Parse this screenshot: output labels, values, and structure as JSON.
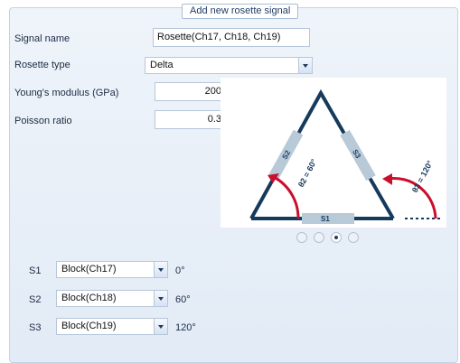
{
  "dialog": {
    "title": "Add new rosette signal"
  },
  "fields": {
    "signal_name_label": "Signal name",
    "signal_name_value": "Rosette(Ch17, Ch18, Ch19)",
    "rosette_type_label": "Rosette type",
    "rosette_type_value": "Delta",
    "youngs_modulus_label": "Young's modulus (GPa)",
    "youngs_modulus_value": "200",
    "poisson_ratio_label": "Poisson ratio",
    "poisson_ratio_value": "0.3"
  },
  "diagram": {
    "gauge_labels": [
      "S1",
      "S2",
      "S3"
    ],
    "angle_labels": [
      "θ2 = 60°",
      "θ3 = 120°"
    ],
    "colors": {
      "frame": "#163a5c",
      "gauge": "#b8c9d8",
      "arc": "#c8102e"
    }
  },
  "carousel": {
    "count": 4,
    "active_index": 2
  },
  "channels": [
    {
      "label": "S1",
      "source": "Block(Ch17)",
      "angle": "0°"
    },
    {
      "label": "S2",
      "source": "Block(Ch18)",
      "angle": "60°"
    },
    {
      "label": "S3",
      "source": "Block(Ch19)",
      "angle": "120°"
    }
  ]
}
